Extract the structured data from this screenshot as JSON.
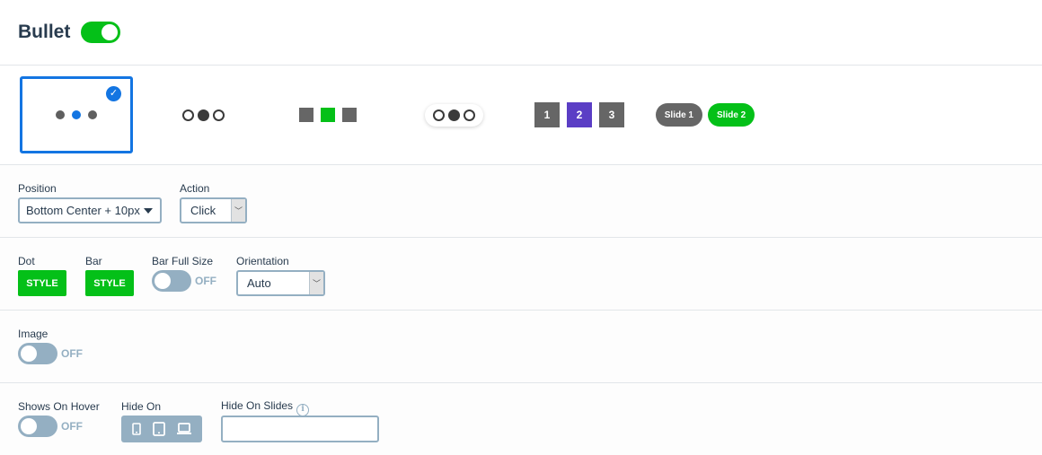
{
  "header": {
    "title": "Bullet",
    "enabled": true
  },
  "bullet_styles": {
    "selected_index": 0,
    "options": [
      {
        "name": "dots",
        "selected": true
      },
      {
        "name": "rings"
      },
      {
        "name": "squares"
      },
      {
        "name": "rings-pill"
      },
      {
        "name": "numbers",
        "items": [
          "1",
          "2",
          "3"
        ],
        "active": "2"
      },
      {
        "name": "titles",
        "items": [
          "Slide 1",
          "Slide 2"
        ],
        "active": "Slide 2"
      }
    ]
  },
  "position": {
    "label": "Position",
    "value": "Bottom Center + 10px"
  },
  "action": {
    "label": "Action",
    "value": "Click"
  },
  "dot": {
    "label": "Dot",
    "button": "STYLE"
  },
  "bar": {
    "label": "Bar",
    "button": "STYLE"
  },
  "bar_full_size": {
    "label": "Bar Full Size",
    "state": "OFF"
  },
  "orientation": {
    "label": "Orientation",
    "value": "Auto"
  },
  "image": {
    "label": "Image",
    "state": "OFF"
  },
  "shows_on_hover": {
    "label": "Shows On Hover",
    "state": "OFF"
  },
  "hide_on": {
    "label": "Hide On",
    "devices": [
      "mobile",
      "tablet",
      "desktop"
    ]
  },
  "hide_on_slides": {
    "label": "Hide On Slides",
    "value": "",
    "info_icon": "i"
  },
  "colors": {
    "accent_green": "#04c018",
    "selected_blue": "#1375e2",
    "number_active": "#5b3ec5",
    "toggle_off": "#94afc2",
    "bullet_gray": "#666666"
  }
}
